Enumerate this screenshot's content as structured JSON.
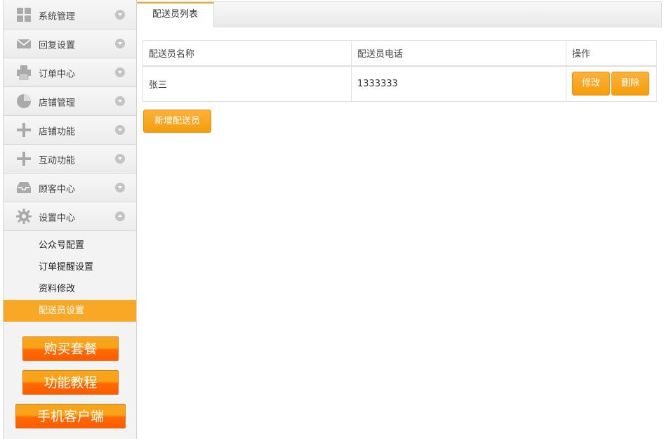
{
  "sidebar": {
    "menu": [
      {
        "label": "系统管理",
        "icon": "grid-icon"
      },
      {
        "label": "回复设置",
        "icon": "envelope-icon"
      },
      {
        "label": "订单中心",
        "icon": "printer-icon"
      },
      {
        "label": "店铺管理",
        "icon": "pie-chart-icon"
      },
      {
        "label": "店铺功能",
        "icon": "plus-icon"
      },
      {
        "label": "互动功能",
        "icon": "plus-icon"
      },
      {
        "label": "顾客中心",
        "icon": "inbox-icon"
      },
      {
        "label": "设置中心",
        "icon": "gear-icon"
      }
    ],
    "submenu": [
      {
        "label": "公众号配置"
      },
      {
        "label": "订单提醒设置"
      },
      {
        "label": "资料修改"
      },
      {
        "label": "配送员设置",
        "active": true
      }
    ],
    "promo": {
      "buy": "购买套餐",
      "tutorial": "功能教程",
      "mobile": "手机客户端"
    }
  },
  "main": {
    "tab": "配送员列表",
    "table": {
      "headers": [
        "配送员名称",
        "配送员电话",
        "操作"
      ],
      "rows": [
        {
          "name": "张三",
          "phone": "1333333",
          "edit": "修改",
          "delete": "删除"
        }
      ]
    },
    "add_button": "新增配送员"
  },
  "colors": {
    "accent": "#f9a825",
    "promo_orange": "#ff6a00"
  }
}
